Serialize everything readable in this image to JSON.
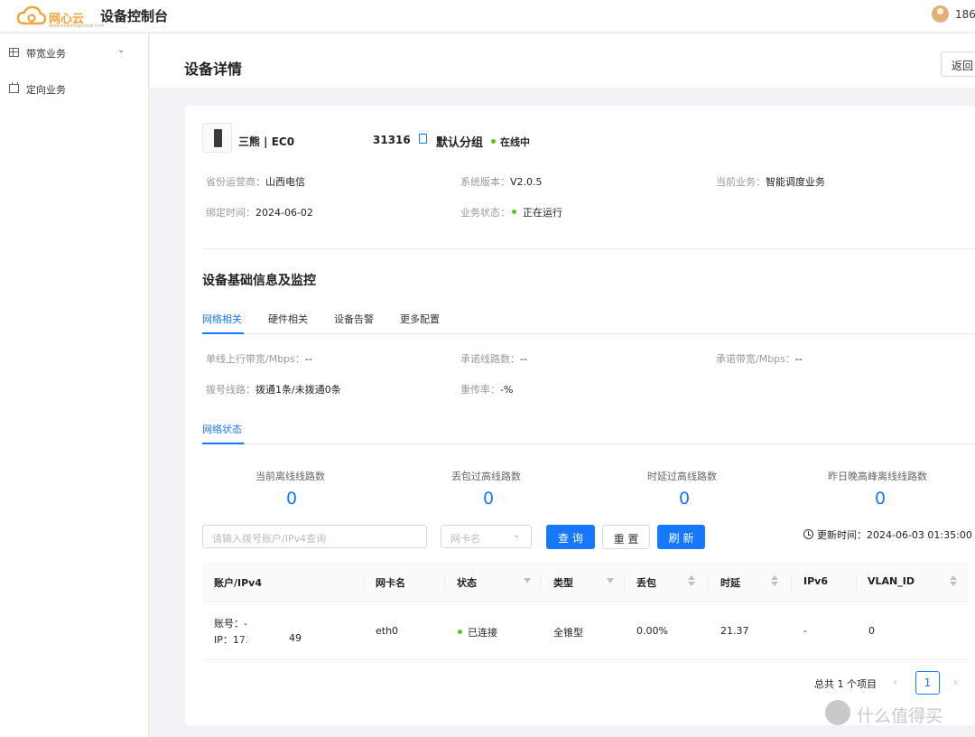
{
  "header": {
    "logo_text": "网心云",
    "logo_sub": "www.onethingcloud.com",
    "title": "设备控制台",
    "user": "186"
  },
  "sidebar": {
    "items": [
      {
        "label": "带宽业务",
        "icon": "grid-icon",
        "expandable": true
      },
      {
        "label": "定向业务",
        "icon": "calendar-icon",
        "expandable": false
      }
    ]
  },
  "page": {
    "title": "设备详情",
    "back_label": "返回"
  },
  "device": {
    "name": "三熊 | EC0",
    "id_suffix": "31316",
    "group": "默认分组",
    "status": "在线中",
    "colors": {
      "online": "#52c41a",
      "accent": "#1677ff"
    },
    "info": [
      {
        "key": "省份运营商：",
        "value": "山西电信"
      },
      {
        "key": "系统版本：",
        "value": "V2.0.5"
      },
      {
        "key": "当前业务：",
        "value": "智能调度业务"
      },
      {
        "key": "绑定时间：",
        "value": "2024-06-02"
      },
      {
        "key": "业务状态：",
        "value": "正在运行"
      }
    ]
  },
  "monitor": {
    "title": "设备基础信息及监控",
    "tabs": [
      "网络相关",
      "硬件相关",
      "设备告警",
      "更多配置"
    ],
    "active_tab": "网络相关",
    "net_info": [
      {
        "key": "单线上行带宽/Mbps：",
        "value": "--"
      },
      {
        "key": "承诺线路数：",
        "value": "--"
      },
      {
        "key": "承诺带宽/Mbps：",
        "value": "--"
      },
      {
        "key": "拨号线路：",
        "value": "拨通1条/未拨通0条"
      },
      {
        "key": "重传率：",
        "value": "-%"
      }
    ],
    "sub_tab": "网络状态",
    "stats": [
      {
        "label": "当前离线线路数",
        "value": "0"
      },
      {
        "label": "丢包过高线路数",
        "value": "0"
      },
      {
        "label": "时延过高线路数",
        "value": "0"
      },
      {
        "label": "昨日晚高峰离线线路数",
        "value": "0"
      }
    ]
  },
  "filters": {
    "search_placeholder": "请输入拨号账户/IPv4查询",
    "nic_placeholder": "网卡名",
    "query": "查 询",
    "reset": "重 置",
    "refresh": "刷 新",
    "updated_label": "更新时间：",
    "updated_value": "2024-06-03 01:35:00"
  },
  "table": {
    "columns": [
      "账户/IPv4",
      "网卡名",
      "状态",
      "类型",
      "丢包",
      "时延",
      "IPv6",
      "VLAN_ID"
    ],
    "rows": [
      {
        "account": "账号：-",
        "ip_prefix": "IP：172",
        "ip_suffix": "49",
        "nic": "eth0",
        "status": "已连接",
        "type": "全锥型",
        "loss": "0.00%",
        "latency": "21.37",
        "ipv6": "-",
        "vlan": "0"
      }
    ]
  },
  "pagination": {
    "total": "总共 1 个项目",
    "current": "1"
  },
  "watermark": {
    "text": "什么值得买"
  }
}
